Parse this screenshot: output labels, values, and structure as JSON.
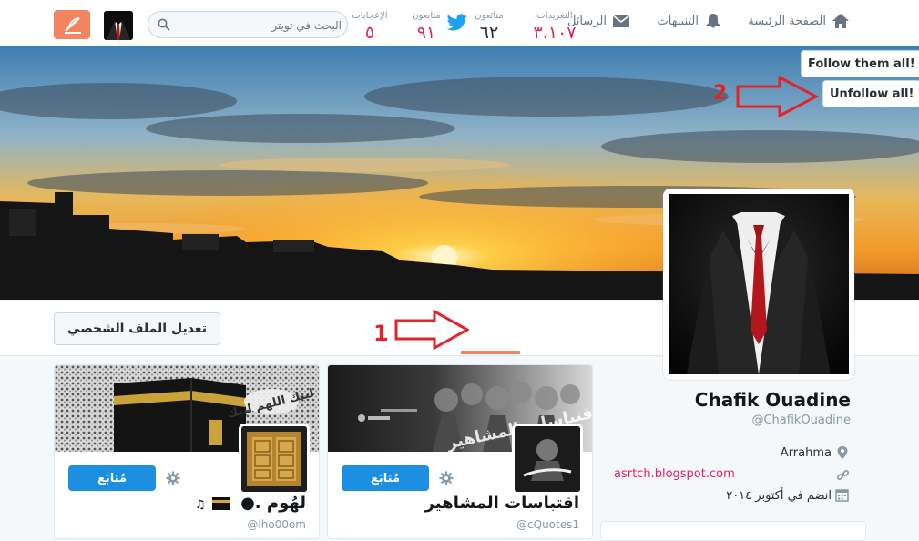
{
  "nav": {
    "home": "الصفحة الرئيسة",
    "notifications": "التنبيهات",
    "messages": "الرسائل",
    "search_placeholder": "البحث في تويتر"
  },
  "banner": {
    "follow_all": "Follow them all!",
    "unfollow_all": "Unfollow all!"
  },
  "stats": [
    {
      "label": "التغريدات",
      "value": "٣،١٠٧"
    },
    {
      "label": "متابَعون",
      "value": "٦٢"
    },
    {
      "label": "متابعون",
      "value": "٩١"
    },
    {
      "label": "الإعجابات",
      "value": "٥"
    }
  ],
  "edit_profile": "تعديل الملف الشخصي",
  "profile": {
    "name": "Chafik Ouadine",
    "handle": "@ChafikOuadine",
    "location": "Arrahma",
    "website": "asrtch.blogspot.com",
    "joined": "انضم في أكتوبر ٢٠١٤"
  },
  "cards": [
    {
      "name": "اقتباسات المشاهير",
      "handle": "@cQuotes1",
      "button": "مُتابَع",
      "cover_text": "اقتباسات المشاهير"
    },
    {
      "name": "لهُوم .●",
      "handle": "@lho00om",
      "button": "مُتابَع"
    }
  ],
  "annotations": {
    "one": "1",
    "two": "2"
  },
  "colors": {
    "accent": "#1da1f2",
    "stat_value": "#e0245e",
    "annotation": "#e0242a",
    "follow_button": "#1d8fe0"
  }
}
